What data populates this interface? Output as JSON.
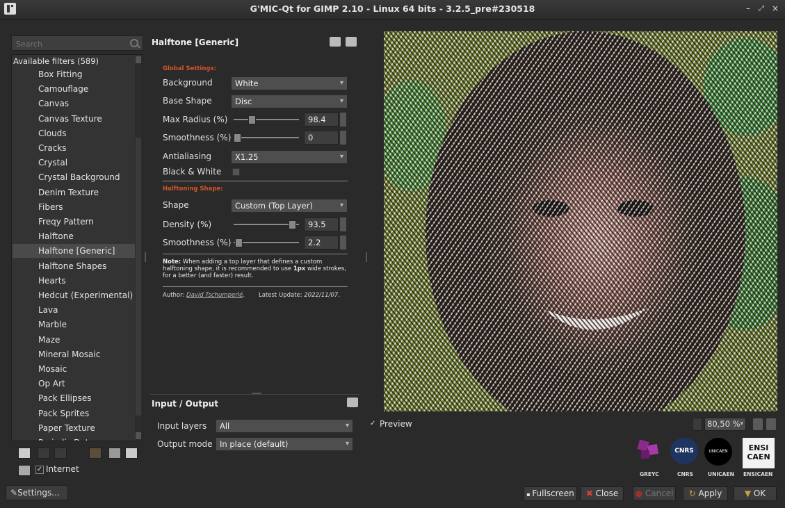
{
  "window": {
    "title": "G'MIC-Qt for GIMP 2.10 - Linux 64 bits - 3.2.5_pre#230518",
    "controls": [
      "–",
      "⤢",
      "×"
    ]
  },
  "left": {
    "search_placeholder": "Search",
    "list_header": "Available filters (589)",
    "filters": [
      "Box Fitting",
      "Camouflage",
      "Canvas",
      "Canvas Texture",
      "Clouds",
      "Cracks",
      "Crystal",
      "Crystal Background",
      "Denim Texture",
      "Fibers",
      "Freqy Pattern",
      "Halftone",
      "Halftone [Generic]",
      "Halftone Shapes",
      "Hearts",
      "Hedcut (Experimental)",
      "Lava",
      "Marble",
      "Maze",
      "Mineral Mosaic",
      "Mosaic",
      "Op Art",
      "Pack Ellipses",
      "Pack Sprites",
      "Paper Texture",
      "Periodic Dots"
    ],
    "selected_filter": "Halftone [Generic]",
    "internet_label": "Internet",
    "settings_label": "Settings..."
  },
  "filter": {
    "title": "Halftone [Generic]",
    "global_settings_title": "Global Settings:",
    "background_label": "Background",
    "background_value": "White",
    "base_shape_label": "Base Shape",
    "base_shape_value": "Disc",
    "max_radius_label": "Max Radius (%)",
    "max_radius_value": "98.4",
    "max_radius_fraction": 0.25,
    "smoothness1_label": "Smoothness (%)",
    "smoothness1_value": "0",
    "antialiasing_label": "Antialiasing",
    "antialiasing_value": "X1.25",
    "bw_label": "Black & White",
    "halftoning_shape_title": "Halftoning Shape:",
    "shape_label": "Shape",
    "shape_value": "Custom (Top Layer)",
    "density_label": "Density (%)",
    "density_value": "93.5",
    "density_fraction": 0.935,
    "smoothness2_label": "Smoothness (%)",
    "smoothness2_value": "2.2",
    "note_bold": "Note:",
    "note_text": " When adding a top layer that defines a custom halftoning shape, it is recommended to use ",
    "note_bold2": "1px",
    "note_text2": " wide strokes, for a better (and faster) result.",
    "author_label": "Author: ",
    "author_name": "David Tschumperlé",
    "update_label": "Latest Update: ",
    "update_date": "2022/11/07"
  },
  "io": {
    "title": "Input / Output",
    "input_layers_label": "Input layers",
    "input_layers_value": "All",
    "output_mode_label": "Output mode",
    "output_mode_value": "In place (default)"
  },
  "preview": {
    "checkbox_label": "Preview",
    "zoom": "80,50 %"
  },
  "logos": {
    "greyc": "GREYC",
    "cnrs": "CNRS",
    "cnrs_mark": "CNRS",
    "unicaen": "UNICAEN",
    "unicaen_mark": "UNICAEN",
    "ensicaen": "ENSICAEN",
    "ensi_line1": "ENSI",
    "ensi_line2": "CAEN"
  },
  "buttons": {
    "fullscreen": "Fullscreen",
    "close": "Close",
    "cancel": "Cancel",
    "apply": "Apply",
    "ok": "OK"
  }
}
